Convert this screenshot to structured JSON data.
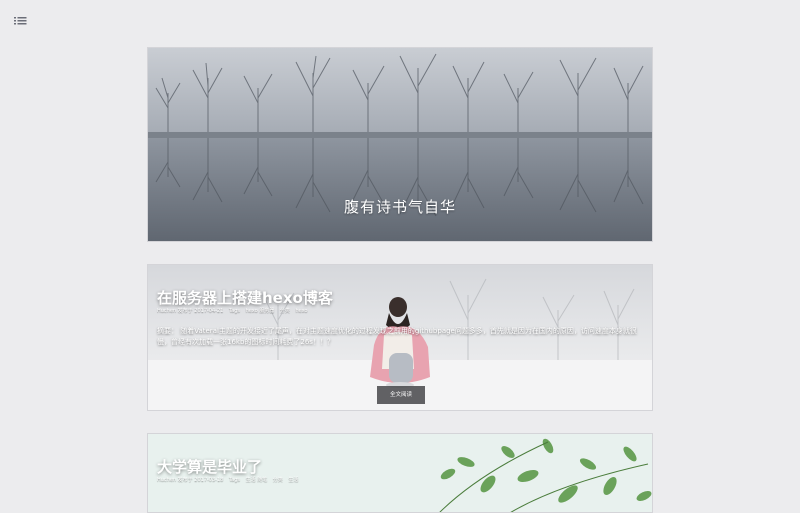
{
  "menu_icon": "list-menu-icon",
  "hero": {
    "title": "腹有诗书气自华"
  },
  "posts": [
    {
      "title": "在服务器上搭建hexo博客",
      "meta": {
        "author": "Huchen 发布于 2017-04-21",
        "tags_label": "Tags",
        "tags": "hexo 服务器",
        "category_label": "分类",
        "category": "hexo"
      },
      "excerpt": "摘要： 随着Vateral主题的开发接近了尾声，在对主题速度优化的过程发现之前用的githubpage问题多多，首先就是因为在国内的原因，访问速度本身就很慢，曾经有次加载一张16kb的图标时间耗费了26s！！？",
      "read_more": "全文阅读"
    },
    {
      "title": "大学算是毕业了",
      "meta": {
        "author": "Huchen 发布于 2017-03-18",
        "tags_label": "Tags",
        "tags": "生活 随笔",
        "category_label": "分类",
        "category": "生活"
      }
    }
  ],
  "colors": {
    "page_bg": "#ececee",
    "read_more_bg": "#46464a"
  }
}
